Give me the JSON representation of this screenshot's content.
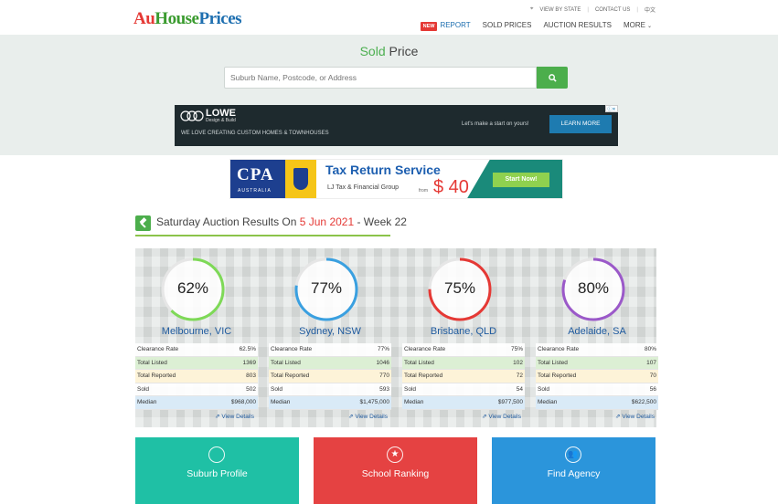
{
  "logo": {
    "au": "Au",
    "house": "House",
    "prices": "Prices"
  },
  "toplinks": {
    "view_by_state": "VIEW BY STATE",
    "contact_us": "CONTACT US",
    "lang": "中文"
  },
  "nav": {
    "badge": "NEW",
    "report": "REPORT",
    "sold_prices": "SOLD PRICES",
    "auction_results": "AUCTION RESULTS",
    "more": "MORE"
  },
  "hero": {
    "title_green": "Sold",
    "title_rest": " Price",
    "search_placeholder": "Suburb Name, Postcode, or Address"
  },
  "ad1": {
    "brand": "LOWE",
    "brand_sub": "Design & Build",
    "tagline": "WE LOVE CREATING CUSTOM HOMES & TOWNHOUSES",
    "cta_text": "Let's make a start on yours!",
    "cta": "LEARN MORE"
  },
  "ad2": {
    "cpa": "CPA",
    "cpa_sub": "AUSTRALIA",
    "title": "Tax Return Service",
    "sub": "LJ Tax & Financial Group",
    "from": "from",
    "price": "$ 40",
    "button": "Start Now!"
  },
  "section": {
    "prefix": "Saturday Auction Results On ",
    "date": "5 Jun 2021",
    "suffix": " - Week 22"
  },
  "row_labels": {
    "clearance": "Clearance Rate",
    "listed": "Total Listed",
    "reported": "Total Reported",
    "sold": "Sold",
    "median": "Median",
    "details": "View Details"
  },
  "colors": {
    "melbourne": "#7ed957",
    "sydney": "#3aa0e0",
    "brisbane": "#e53935",
    "adelaide": "#9b59c9"
  },
  "cities": [
    {
      "pct": "62%",
      "pct_value": 62.5,
      "name": "Melbourne, VIC",
      "clearance": "62.5%",
      "listed": "1369",
      "reported": "803",
      "sold": "502",
      "median": "$968,000"
    },
    {
      "pct": "77%",
      "pct_value": 77,
      "name": "Sydney, NSW",
      "clearance": "77%",
      "listed": "1046",
      "reported": "770",
      "sold": "593",
      "median": "$1,475,000"
    },
    {
      "pct": "75%",
      "pct_value": 75,
      "name": "Brisbane, QLD",
      "clearance": "75%",
      "listed": "102",
      "reported": "72",
      "sold": "54",
      "median": "$977,500"
    },
    {
      "pct": "80%",
      "pct_value": 80,
      "name": "Adelaide, SA",
      "clearance": "80%",
      "listed": "107",
      "reported": "70",
      "sold": "56",
      "median": "$622,500"
    }
  ],
  "tiles": {
    "suburb": "Suburb Profile",
    "ranking": "School Ranking",
    "agency": "Find Agency"
  }
}
